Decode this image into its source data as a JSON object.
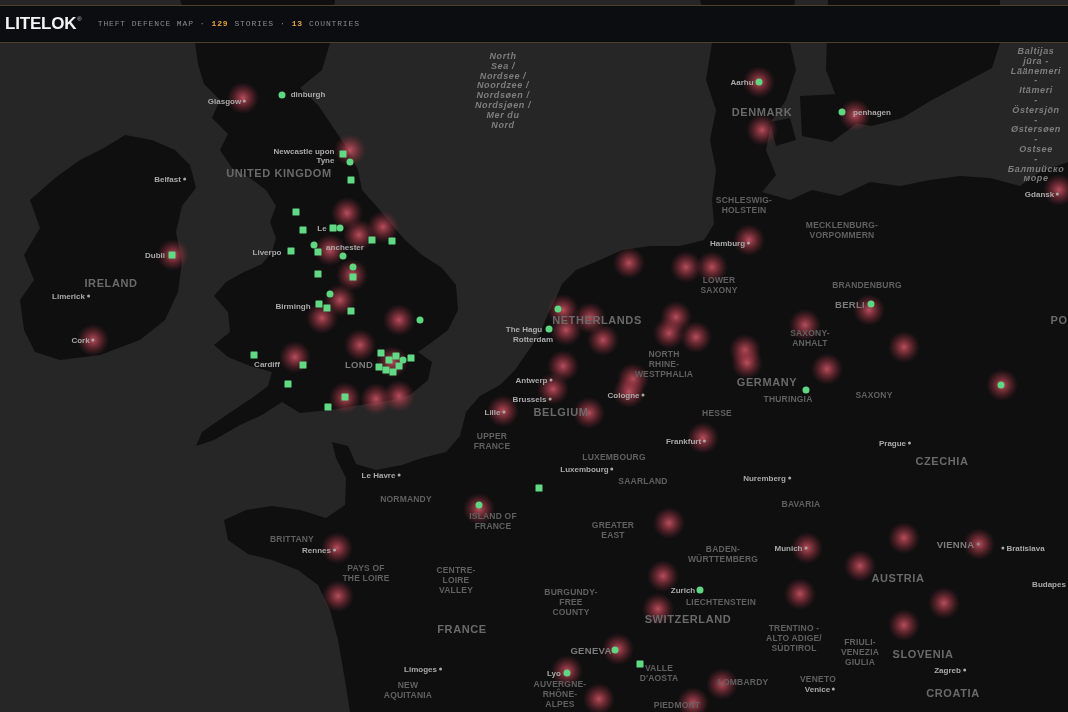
{
  "header": {
    "logo": "LITELOK",
    "logo_mark": "®",
    "title": "THEFT DEFENCE MAP",
    "stats": [
      {
        "separator": "·",
        "value": "129",
        "label": "STORIES"
      },
      {
        "separator": "·",
        "value": "13",
        "label": "COUNTRIES"
      }
    ]
  },
  "map": {
    "labels": [
      {
        "kind": "city",
        "text": "dinburgh"
      },
      {
        "kind": "city",
        "text": "Glasgow"
      },
      {
        "kind": "sea",
        "lines": [
          "North",
          "Sea /",
          "Nordsee /",
          "Noordzee /",
          "Nordsøen /",
          "Nordsjøen /",
          "Mer du",
          "Nord"
        ]
      },
      {
        "kind": "city",
        "text": "Aarhu"
      },
      {
        "kind": "country",
        "text": "DENMARK"
      },
      {
        "kind": "city",
        "text": "penhagen"
      },
      {
        "kind": "city",
        "lines": [
          "Newcastle upon",
          "Tyne"
        ]
      },
      {
        "kind": "city",
        "text": "Belfast"
      },
      {
        "kind": "country",
        "text": "UNITED KINGDOM"
      },
      {
        "kind": "sea",
        "lines": [
          "Baltijas",
          "jūra -",
          "Läänemeri",
          "-",
          "Itämeri",
          "-",
          "Östersjön",
          "-",
          "Østersøen",
          "-",
          "Ostsee",
          "-",
          "Балтийско",
          "море"
        ]
      },
      {
        "kind": "city",
        "text": "Gdansk"
      },
      {
        "kind": "region",
        "lines": [
          "SCHLESWIG-",
          "HOLSTEIN"
        ]
      },
      {
        "kind": "city",
        "text": "Le"
      },
      {
        "kind": "region",
        "lines": [
          "MECKLENBURG-",
          "VORPOMMERN"
        ]
      },
      {
        "kind": "city",
        "text": "anchester"
      },
      {
        "kind": "city",
        "text": "Hamburg"
      },
      {
        "kind": "city",
        "text": "Dubli"
      },
      {
        "kind": "city",
        "text": "Liverpo"
      },
      {
        "kind": "country",
        "text": "IRELAND"
      },
      {
        "kind": "region",
        "lines": [
          "LOWER",
          "SAXONY"
        ]
      },
      {
        "kind": "region",
        "text": "BRANDENBURG"
      },
      {
        "kind": "city",
        "text": "Limerick"
      },
      {
        "kind": "city",
        "text": "Birmingh"
      },
      {
        "kind": "capital",
        "text": "BERLI"
      },
      {
        "kind": "country",
        "text": "NETHERLANDS"
      },
      {
        "kind": "country",
        "text": "PO"
      },
      {
        "kind": "city",
        "text": "The Hagu"
      },
      {
        "kind": "city",
        "text": "Cork"
      },
      {
        "kind": "city",
        "text": "Rotterdam"
      },
      {
        "kind": "region",
        "lines": [
          "SAXONY-",
          "ANHALT"
        ]
      },
      {
        "kind": "city",
        "text": "Cardiff"
      },
      {
        "kind": "capital",
        "text": "LOND"
      },
      {
        "kind": "region",
        "lines": [
          "NORTH",
          "RHINE-",
          "WESTPHALIA"
        ]
      },
      {
        "kind": "city",
        "text": "Antwerp"
      },
      {
        "kind": "country",
        "text": "GERMANY"
      },
      {
        "kind": "city",
        "text": "Brussels"
      },
      {
        "kind": "city",
        "text": "Cologne"
      },
      {
        "kind": "region",
        "text": "THURINGIA"
      },
      {
        "kind": "region",
        "text": "SAXONY"
      },
      {
        "kind": "city",
        "text": "Lille"
      },
      {
        "kind": "country",
        "text": "BELGIUM"
      },
      {
        "kind": "region",
        "text": "HESSE"
      },
      {
        "kind": "region",
        "lines": [
          "UPPER",
          "FRANCE"
        ]
      },
      {
        "kind": "city",
        "text": "Frankfurt"
      },
      {
        "kind": "city",
        "text": "Prague"
      },
      {
        "kind": "region",
        "text": "LUXEMBOURG"
      },
      {
        "kind": "country",
        "text": "CZECHIA"
      },
      {
        "kind": "city",
        "text": "Luxembourg"
      },
      {
        "kind": "city",
        "text": "Le Havre"
      },
      {
        "kind": "region",
        "text": "SAARLAND"
      },
      {
        "kind": "city",
        "text": "Nuremberg"
      },
      {
        "kind": "region",
        "text": "NORMANDY"
      },
      {
        "kind": "region",
        "text": "BAVARIA"
      },
      {
        "kind": "region",
        "lines": [
          "ISLAND OF",
          "FRANCE"
        ]
      },
      {
        "kind": "region",
        "lines": [
          "GREATER",
          "EAST"
        ]
      },
      {
        "kind": "region",
        "text": "BRITTANY"
      },
      {
        "kind": "city",
        "text": "Rennes"
      },
      {
        "kind": "region",
        "lines": [
          "BADEN-",
          "WÜRTTEMBERG"
        ]
      },
      {
        "kind": "city",
        "text": "Munich"
      },
      {
        "kind": "capital",
        "text": "VIENNA"
      },
      {
        "kind": "city",
        "text": "Bratislava"
      },
      {
        "kind": "region",
        "lines": [
          "PAYS OF",
          "THE LOIRE"
        ]
      },
      {
        "kind": "region",
        "lines": [
          "CENTRE-",
          "LOIRE",
          "VALLEY"
        ]
      },
      {
        "kind": "country",
        "text": "AUSTRIA"
      },
      {
        "kind": "city",
        "text": "Budapes"
      },
      {
        "kind": "region",
        "lines": [
          "BURGUNDY-",
          "FREE",
          "COUNTY"
        ]
      },
      {
        "kind": "city",
        "text": "Zurich"
      },
      {
        "kind": "region",
        "text": "LIECHTENSTEIN"
      },
      {
        "kind": "country",
        "text": "SWITZERLAND"
      },
      {
        "kind": "country",
        "text": "FRANCE"
      },
      {
        "kind": "capital",
        "text": "GENEVA"
      },
      {
        "kind": "region",
        "lines": [
          "TRENTINO -",
          "ALTO ADIGE/",
          "SÜDTIROL"
        ]
      },
      {
        "kind": "region",
        "lines": [
          "FRIULI-",
          "VENEZIA",
          "GIULIA"
        ]
      },
      {
        "kind": "country",
        "text": "SLOVENIA"
      },
      {
        "kind": "city",
        "text": "Limoges"
      },
      {
        "kind": "city",
        "text": "Lyo"
      },
      {
        "kind": "region",
        "lines": [
          "VALLE",
          "D'AOSTA"
        ]
      },
      {
        "kind": "city",
        "text": "Zagreb"
      },
      {
        "kind": "region",
        "lines": [
          "NEW",
          "AQUITANIA"
        ]
      },
      {
        "kind": "region",
        "lines": [
          "AUVERGNE-",
          "RHÔNE-",
          "ALPES"
        ]
      },
      {
        "kind": "region",
        "text": "LOMBARDY"
      },
      {
        "kind": "region",
        "text": "VENETO"
      },
      {
        "kind": "city",
        "text": "Venice"
      },
      {
        "kind": "country",
        "text": "CROATIA"
      },
      {
        "kind": "region",
        "text": "PIEDMONT"
      }
    ],
    "story_markers": [
      {
        "kind": "square"
      },
      {
        "kind": "dot"
      },
      {
        "kind": "square"
      },
      {
        "kind": "square"
      },
      {
        "kind": "square"
      },
      {
        "kind": "square"
      },
      {
        "kind": "dot"
      },
      {
        "kind": "square"
      },
      {
        "kind": "dot"
      },
      {
        "kind": "square"
      },
      {
        "kind": "dot"
      },
      {
        "kind": "dot"
      },
      {
        "kind": "square"
      },
      {
        "kind": "square"
      },
      {
        "kind": "dot"
      },
      {
        "kind": "square"
      },
      {
        "kind": "square"
      },
      {
        "kind": "square"
      },
      {
        "kind": "square"
      },
      {
        "kind": "square"
      },
      {
        "kind": "dot"
      },
      {
        "kind": "square"
      },
      {
        "kind": "square"
      },
      {
        "kind": "square"
      },
      {
        "kind": "square"
      },
      {
        "kind": "square"
      },
      {
        "kind": "square"
      },
      {
        "kind": "square"
      },
      {
        "kind": "square"
      },
      {
        "kind": "dot"
      },
      {
        "kind": "square"
      },
      {
        "kind": "square"
      },
      {
        "kind": "square"
      },
      {
        "kind": "square"
      },
      {
        "kind": "square"
      },
      {
        "kind": "square"
      },
      {
        "kind": "dot"
      },
      {
        "kind": "dot"
      },
      {
        "kind": "dot"
      },
      {
        "kind": "dot"
      },
      {
        "kind": "dot"
      },
      {
        "kind": "dot"
      },
      {
        "kind": "dot"
      },
      {
        "kind": "dot"
      },
      {
        "kind": "dot"
      },
      {
        "kind": "square"
      },
      {
        "kind": "dot"
      },
      {
        "kind": "dot"
      },
      {
        "kind": "dot"
      },
      {
        "kind": "square"
      }
    ]
  }
}
